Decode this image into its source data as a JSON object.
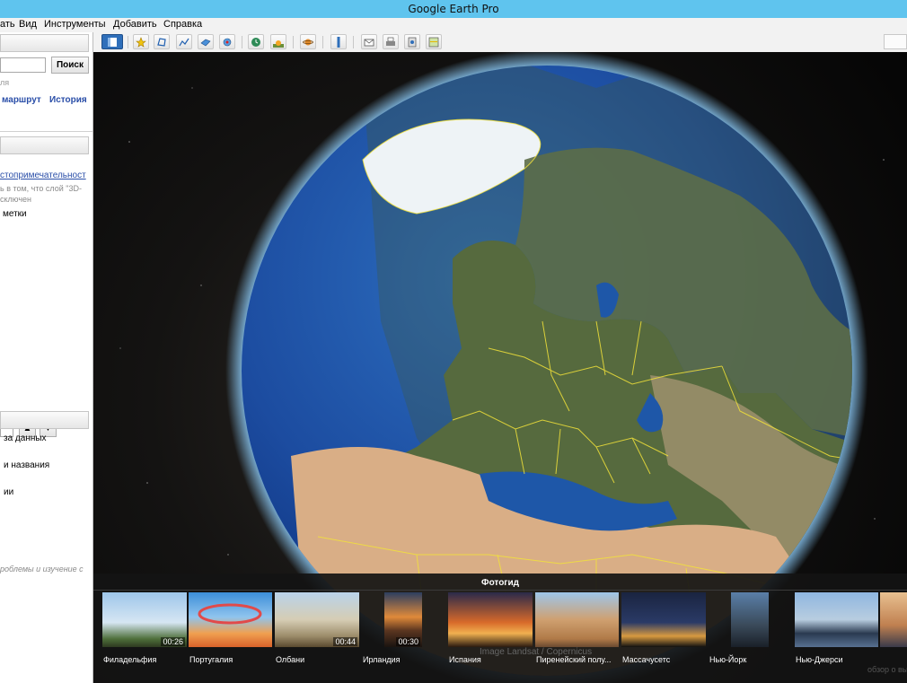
{
  "window": {
    "title": "Google Earth Pro"
  },
  "menu": [
    {
      "label": "ать"
    },
    {
      "label": "Вид"
    },
    {
      "label": "Инструменты"
    },
    {
      "label": "Добавить"
    },
    {
      "label": "Справка"
    }
  ],
  "toolbar": {
    "buttons": [
      "sidebar-toggle-icon",
      "placemark-icon",
      "polygon-icon",
      "path-icon",
      "overlay-icon",
      "record-tour-icon",
      "historical-imagery-icon",
      "sunlight-icon",
      "planets-icon",
      "ruler-icon",
      "email-icon",
      "print-icon",
      "save-image-icon",
      "view-in-maps-icon"
    ]
  },
  "sidebar": {
    "search_button": "Поиск",
    "search_hint": "ля",
    "links": {
      "route": "маршрут",
      "history": "История"
    },
    "places": {
      "tour_link": "стопримечательност",
      "note_line1": "ь в том, что слой \"3D-",
      "note_line2": "сключен",
      "my_places": "метки"
    },
    "layers": {
      "items": [
        "за данных",
        "и названия",
        "ии"
      ],
      "footer": "роблемы и изучение с"
    },
    "nav": {
      "up": "▲",
      "down": "▼"
    }
  },
  "tour": {
    "title": "Фотогид",
    "items": [
      {
        "label": "Филадельфия",
        "duration": "00:26"
      },
      {
        "label": "Португалия",
        "duration": ""
      },
      {
        "label": "Олбани",
        "duration": "00:44"
      },
      {
        "label": "Ирландия",
        "duration": "00:30"
      },
      {
        "label": "Испания",
        "duration": ""
      },
      {
        "label": "Пиренейский полу...",
        "duration": ""
      },
      {
        "label": "Массачусетс",
        "duration": ""
      },
      {
        "label": "Нью-Йорк",
        "duration": ""
      },
      {
        "label": "Нью-Джерси",
        "duration": ""
      }
    ],
    "watermark": "Image Landsat / Copernicus",
    "corner": "обзор о высоте"
  },
  "colors": {
    "titlebar": "#5fc4ee",
    "border_lines": "#f2e23a",
    "ocean": "#1f4fa0",
    "tour_bg": "#141414"
  }
}
